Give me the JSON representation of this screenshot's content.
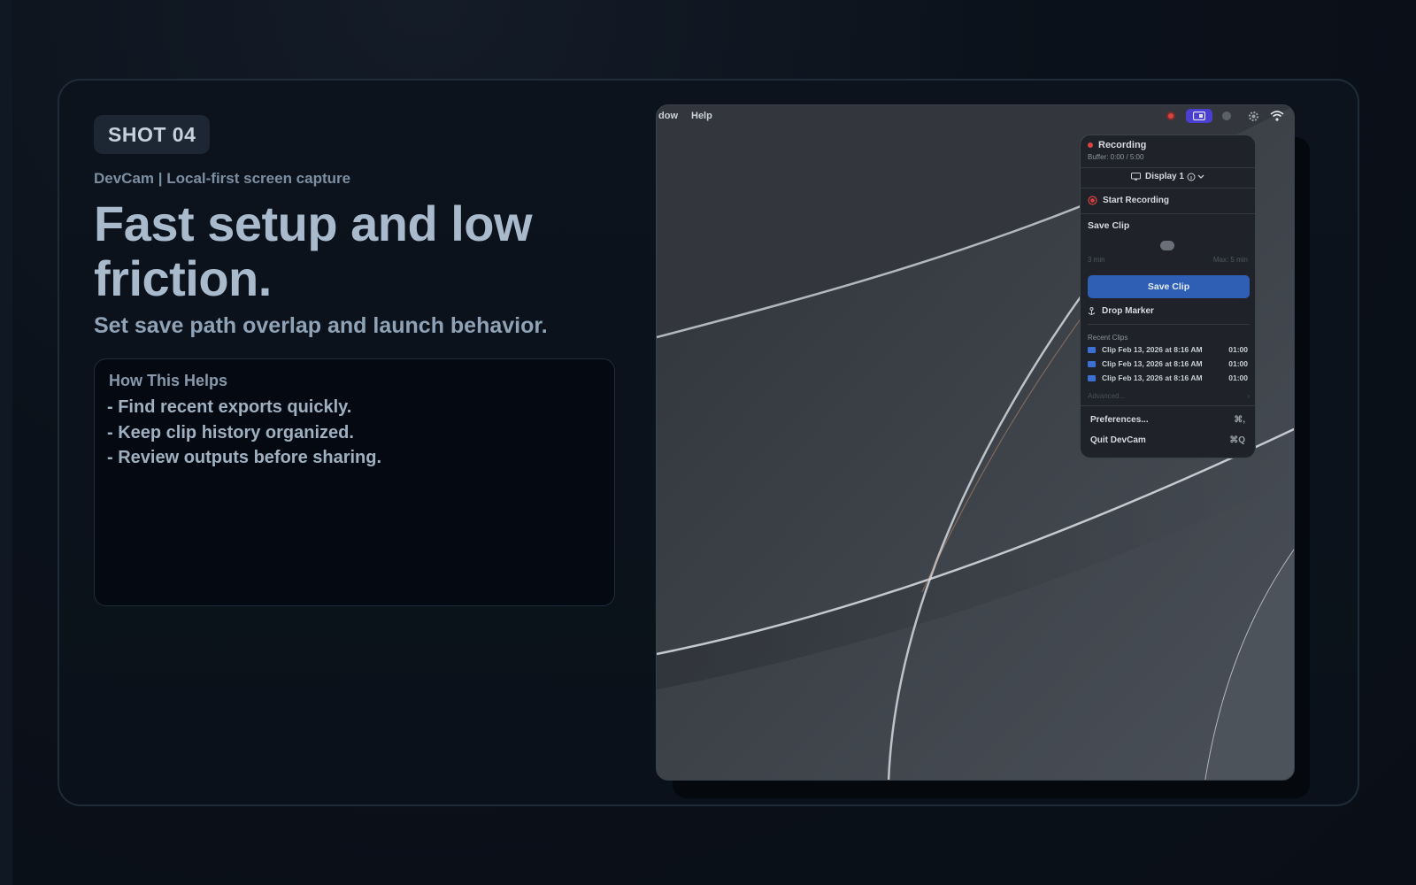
{
  "slide": {
    "badge": "SHOT 04",
    "subtitle": "DevCam | Local-first screen capture",
    "headline": "Fast setup and low friction.",
    "tagline": "Set save path overlap and launch behavior.",
    "helps": {
      "title": "How This Helps",
      "items": [
        "- Find recent exports quickly.",
        "- Keep clip history organized.",
        "- Review outputs before sharing."
      ]
    }
  },
  "menubar": {
    "items": [
      "dow",
      "Help"
    ],
    "tray_icons": [
      "record-status-icon",
      "devcam-menu-icon",
      "circle-icon",
      "gear-icon",
      "wifi-icon"
    ]
  },
  "popover": {
    "status_title": "Recording",
    "buffer": "Buffer: 0:00 / 5:00",
    "display_select": "Display 1",
    "start_recording": "Start Recording",
    "save_clip_heading": "Save Clip",
    "slider_min": "3 min",
    "slider_max": "Max: 5 min",
    "slider_fraction": 0.0,
    "save_clip_button": "Save Clip",
    "drop_marker": "Drop Marker",
    "recent_clips_heading": "Recent Clips",
    "recent_clips": [
      {
        "name": "Clip Feb 13, 2026 at 8:16 AM",
        "duration": "01:00"
      },
      {
        "name": "Clip Feb 13, 2026 at 8:16 AM",
        "duration": "01:00"
      },
      {
        "name": "Clip Feb 13, 2026 at 8:16 AM",
        "duration": "01:00"
      }
    ],
    "advanced": "Advanced...",
    "preferences": "Preferences...",
    "preferences_shortcut": "⌘,",
    "quit": "Quit DevCam",
    "quit_shortcut": "⌘Q"
  },
  "colors": {
    "accent": "#2f5fb5",
    "record": "#d94343",
    "tray_active": "#4b3fd0"
  }
}
